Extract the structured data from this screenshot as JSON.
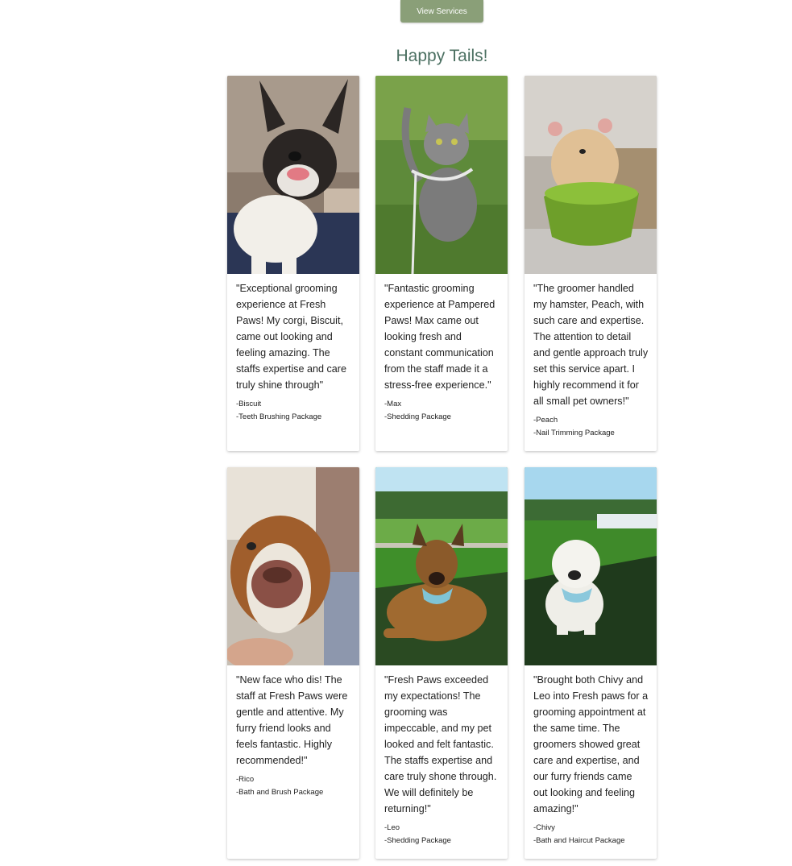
{
  "header": {
    "view_services_label": "View Services"
  },
  "section": {
    "title": "Happy Tails!"
  },
  "testimonials": [
    {
      "quote": "\"Exceptional grooming experience at Fresh Paws! My corgi, Biscuit, came out looking and feeling amazing. The staffs expertise and care truly shine through\"",
      "pet": "-Biscuit",
      "package": "-Teeth Brushing Package",
      "photo_icon": "dog-photo"
    },
    {
      "quote": "\"Fantastic grooming experience at Pampered Paws! Max came out looking fresh and constant communication from the staff made it a stress-free experience.\"",
      "pet": "-Max",
      "package": "-Shedding Package",
      "photo_icon": "cat-photo"
    },
    {
      "quote": "\"The groomer handled my hamster, Peach, with such care and expertise. The attention to detail and gentle approach truly set this service apart. I highly recommend it for all small pet owners!\"",
      "pet": "-Peach",
      "package": "-Nail Trimming Package",
      "photo_icon": "hamster-photo"
    },
    {
      "quote": "\"New face who dis! The staff at Fresh Paws were gentle and attentive. My furry friend looks and feels fantastic. Highly recommended!\"",
      "pet": "-Rico",
      "package": "-Bath and Brush Package",
      "photo_icon": "dog-photo"
    },
    {
      "quote": "\"Fresh Paws exceeded my expectations! The grooming was impeccable, and my pet looked and felt fantastic. The staffs expertise and care truly shone through. We will definitely be returning!\"",
      "pet": "-Leo",
      "package": "-Shedding Package",
      "photo_icon": "dog-photo"
    },
    {
      "quote": "\"Brought both Chivy and Leo into Fresh paws for a grooming appointment at the same time. The groomers showed great care and expertise, and our furry friends came out looking and feeling amazing!\"",
      "pet": "-Chivy",
      "package": "-Bath and Haircut Package",
      "photo_icon": "dog-photo"
    }
  ],
  "colors": {
    "button_bg": "#8a9f78",
    "title_text": "#4c7062"
  }
}
